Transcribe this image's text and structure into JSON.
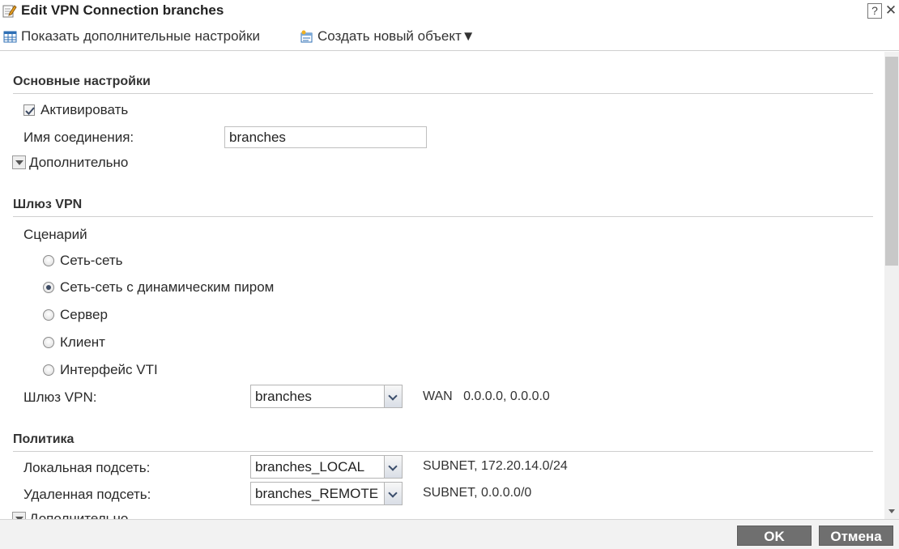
{
  "window": {
    "title": "Edit VPN Connection branches",
    "help_label": "?",
    "close_label": "✕"
  },
  "toolbar": {
    "show_advanced_label": "Показать дополнительные настройки",
    "create_object_label": "Создать новый объект▼"
  },
  "general": {
    "header": "Основные настройки",
    "enable_label": "Активировать",
    "enable_checked": true,
    "connection_name_label": "Имя соединения:",
    "connection_name_value": "branches",
    "advanced_label": "Дополнительно"
  },
  "gateway": {
    "header": "Шлюз VPN",
    "scenario_label": "Сценарий",
    "scenarios": [
      {
        "label": "Сеть-сеть",
        "checked": false
      },
      {
        "label": "Сеть-сеть с динамическим пиром",
        "checked": true
      },
      {
        "label": "Сервер",
        "checked": false
      },
      {
        "label": "Клиент",
        "checked": false
      },
      {
        "label": "Интерфейс VTI",
        "checked": false
      }
    ],
    "vpn_gateway_label": "Шлюз VPN:",
    "vpn_gateway_value": "branches",
    "vpn_gateway_info": "WAN   0.0.0.0, 0.0.0.0"
  },
  "policy": {
    "header": "Политика",
    "local_label": "Локальная подсеть:",
    "local_value": "branches_LOCAL",
    "local_info": "SUBNET, 172.20.14.0/24",
    "remote_label": "Удаленная подсеть:",
    "remote_value": "branches_REMOTE",
    "remote_info": "SUBNET, 0.0.0.0/0",
    "advanced_label": "Дополнительно"
  },
  "footer": {
    "ok_label": "OK",
    "cancel_label": "Отмена"
  },
  "colors": {
    "button_bg": "#6f6f6f",
    "radio_dot": "#3c4a63"
  }
}
